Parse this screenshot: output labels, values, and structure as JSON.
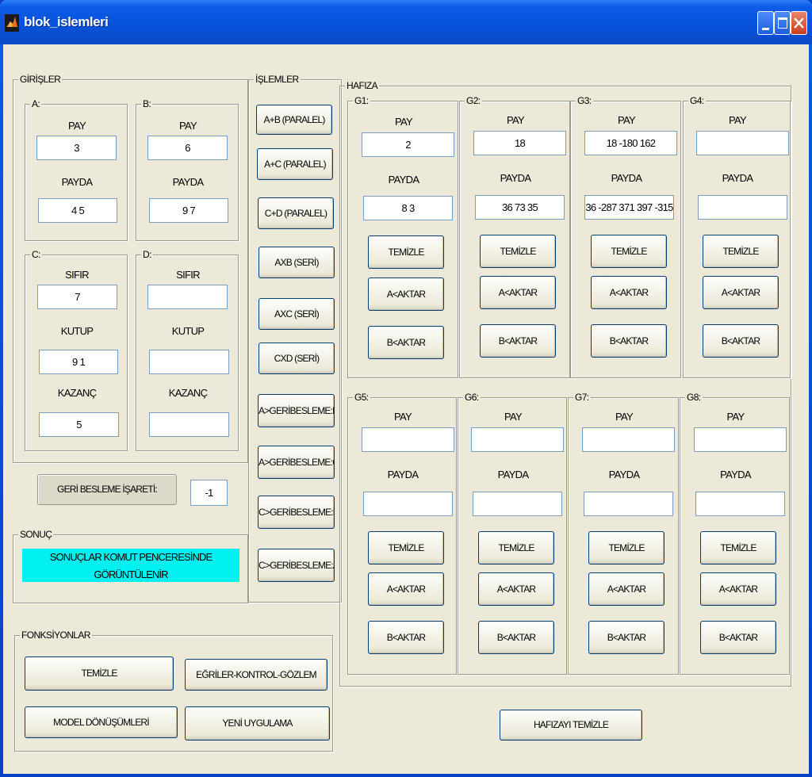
{
  "window": {
    "title": "blok_islemleri"
  },
  "girisler": {
    "title": "GİRİŞLER",
    "A": {
      "title": "A:",
      "pay_label": "PAY",
      "pay_value": "3",
      "payda_label": "PAYDA",
      "payda_value": "4 5"
    },
    "B": {
      "title": "B:",
      "pay_label": "PAY",
      "pay_value": "6",
      "payda_label": "PAYDA",
      "payda_value": "9 7"
    },
    "C": {
      "title": "C:",
      "sifir_label": "SIFIR",
      "sifir_value": "7",
      "kutup_label": "KUTUP",
      "kutup_value": "9 1",
      "kazanc_label": "KAZANÇ",
      "kazanc_value": "5"
    },
    "D": {
      "title": "D:",
      "sifir_label": "SIFIR",
      "sifir_value": "",
      "kutup_label": "KUTUP",
      "kutup_value": "",
      "kazanc_label": "KAZANÇ",
      "kazanc_value": ""
    }
  },
  "geri_besleme": {
    "label": "GERİ BESLEME İŞARETİ:",
    "value": "-1"
  },
  "sonuc": {
    "title": "SONUÇ",
    "text": "SONUÇLAR KOMUT PENCERESİNDE GÖRÜNTÜLENİR"
  },
  "islemler": {
    "title": "İŞLEMLER",
    "buttons": [
      "A+B (PARALEL)",
      "A+C (PARALEL)",
      "C+D (PARALEL)",
      "AXB (SERİ)",
      "AXC (SERİ)",
      "CXD (SERİ)",
      "A>GERİBESLEME:B",
      "A>GERİBESLEME:C",
      "C>GERİBESLEME:D",
      "C>GERİBESLEME:A"
    ]
  },
  "hafiza": {
    "title": "HAFIZA",
    "pay_label": "PAY",
    "payda_label": "PAYDA",
    "temizle_label": "TEMİZLE",
    "a_aktar_label": "A<AKTAR",
    "b_aktar_label": "B<AKTAR",
    "clear_all_label": "HAFIZAYI TEMİZLE",
    "slots": [
      {
        "title": "G1:",
        "pay": "2",
        "payda": "8 3"
      },
      {
        "title": "G2:",
        "pay": "18",
        "payda": "36 73 35"
      },
      {
        "title": "G3:",
        "pay": "18 -180 162",
        "payda": "36 -287  371 397 -315"
      },
      {
        "title": "G4:",
        "pay": "",
        "payda": ""
      },
      {
        "title": "G5:",
        "pay": "",
        "payda": ""
      },
      {
        "title": "G6:",
        "pay": "",
        "payda": ""
      },
      {
        "title": "G7:",
        "pay": "",
        "payda": ""
      },
      {
        "title": "G8:",
        "pay": "",
        "payda": ""
      }
    ]
  },
  "fonksiyonlar": {
    "title": "FONKSİYONLAR",
    "temizle": "TEMİZLE",
    "egriler": "EĞRİLER-KONTROL-GÖZLEM",
    "model": "MODEL DÖNÜŞÜMLERİ",
    "yeni": "YENİ UYGULAMA"
  },
  "colors": {
    "result_bg": "#00f0f0",
    "window_bg": "#ece9d8",
    "titlebar": "#0752d9"
  }
}
